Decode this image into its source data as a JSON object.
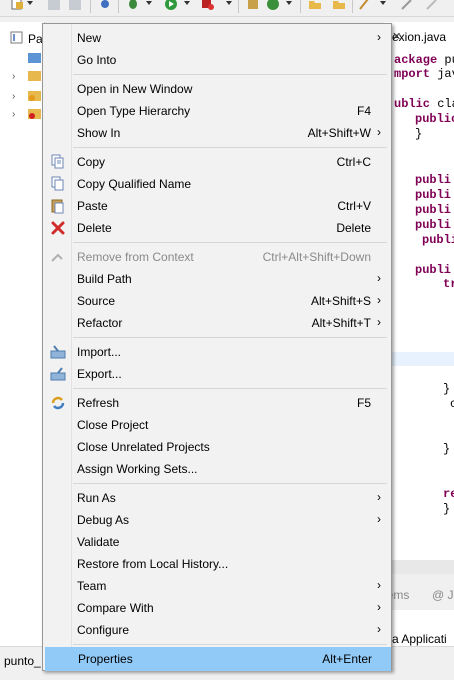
{
  "explorer": {
    "tab_label": "Pa"
  },
  "editor": {
    "tab_title": "exion.java",
    "lines": [
      {
        "kw": "ackage",
        "rest": " pu"
      },
      {
        "kw": "mport",
        "rest": " jav"
      },
      {
        "kw": "ublic",
        "rest": " cla"
      },
      {
        "kw": "public",
        "rest": ""
      },
      {
        "kw": "",
        "rest": "}"
      },
      {
        "kw": "publi",
        "rest": ""
      },
      {
        "kw": "publi",
        "rest": ""
      },
      {
        "kw": "publi",
        "rest": ""
      },
      {
        "kw": "publi",
        "rest": ""
      },
      {
        "kw": "publi",
        "rest": ""
      },
      {
        "kw": "publi",
        "rest": ""
      },
      {
        "kw": "tr",
        "rest": ""
      },
      {
        "kw": "",
        "rest": "}"
      },
      {
        "kw": "",
        "rest": "c"
      },
      {
        "kw": "",
        "rest": "}"
      },
      {
        "kw": "re",
        "rest": ""
      },
      {
        "kw": "",
        "rest": "}"
      }
    ],
    "bottom_tab_1": "lems",
    "bottom_tab_2": "@ J",
    "console_text": "va Applicati"
  },
  "status": {
    "text": "punto_"
  },
  "menu": {
    "items": [
      {
        "label": "New",
        "shortcut": "",
        "submenu": true,
        "icon": "",
        "disabled": false
      },
      {
        "label": "Go Into",
        "shortcut": "",
        "submenu": false,
        "icon": "",
        "disabled": false
      },
      {
        "label": "Open in New Window",
        "shortcut": "",
        "submenu": false,
        "icon": "",
        "disabled": false
      },
      {
        "label": "Open Type Hierarchy",
        "shortcut": "F4",
        "submenu": false,
        "icon": "",
        "disabled": false
      },
      {
        "label": "Show In",
        "shortcut": "Alt+Shift+W",
        "submenu": true,
        "icon": "",
        "disabled": false
      },
      {
        "label": "Copy",
        "shortcut": "Ctrl+C",
        "submenu": false,
        "icon": "copy-icon",
        "disabled": false
      },
      {
        "label": "Copy Qualified Name",
        "shortcut": "",
        "submenu": false,
        "icon": "copy-qualified-icon",
        "disabled": false
      },
      {
        "label": "Paste",
        "shortcut": "Ctrl+V",
        "submenu": false,
        "icon": "paste-icon",
        "disabled": false
      },
      {
        "label": "Delete",
        "shortcut": "Delete",
        "submenu": false,
        "icon": "delete-icon",
        "disabled": false
      },
      {
        "label": "Remove from Context",
        "shortcut": "Ctrl+Alt+Shift+Down",
        "submenu": false,
        "icon": "remove-context-icon",
        "disabled": true
      },
      {
        "label": "Build Path",
        "shortcut": "",
        "submenu": true,
        "icon": "",
        "disabled": false
      },
      {
        "label": "Source",
        "shortcut": "Alt+Shift+S",
        "submenu": true,
        "icon": "",
        "disabled": false
      },
      {
        "label": "Refactor",
        "shortcut": "Alt+Shift+T",
        "submenu": true,
        "icon": "",
        "disabled": false
      },
      {
        "label": "Import...",
        "shortcut": "",
        "submenu": false,
        "icon": "import-icon",
        "disabled": false
      },
      {
        "label": "Export...",
        "shortcut": "",
        "submenu": false,
        "icon": "export-icon",
        "disabled": false
      },
      {
        "label": "Refresh",
        "shortcut": "F5",
        "submenu": false,
        "icon": "refresh-icon",
        "disabled": false
      },
      {
        "label": "Close Project",
        "shortcut": "",
        "submenu": false,
        "icon": "",
        "disabled": false
      },
      {
        "label": "Close Unrelated Projects",
        "shortcut": "",
        "submenu": false,
        "icon": "",
        "disabled": false
      },
      {
        "label": "Assign Working Sets...",
        "shortcut": "",
        "submenu": false,
        "icon": "",
        "disabled": false
      },
      {
        "label": "Run As",
        "shortcut": "",
        "submenu": true,
        "icon": "",
        "disabled": false
      },
      {
        "label": "Debug As",
        "shortcut": "",
        "submenu": true,
        "icon": "",
        "disabled": false
      },
      {
        "label": "Validate",
        "shortcut": "",
        "submenu": false,
        "icon": "",
        "disabled": false
      },
      {
        "label": "Restore from Local History...",
        "shortcut": "",
        "submenu": false,
        "icon": "",
        "disabled": false
      },
      {
        "label": "Team",
        "shortcut": "",
        "submenu": true,
        "icon": "",
        "disabled": false
      },
      {
        "label": "Compare With",
        "shortcut": "",
        "submenu": true,
        "icon": "",
        "disabled": false
      },
      {
        "label": "Configure",
        "shortcut": "",
        "submenu": true,
        "icon": "",
        "disabled": false
      },
      {
        "label": "Properties",
        "shortcut": "Alt+Enter",
        "submenu": false,
        "icon": "",
        "disabled": false,
        "selected": true
      }
    ]
  },
  "colors": {
    "menu_bg": "#f2f2f2",
    "selection": "#91c9f7",
    "keyword": "#7f0055"
  }
}
